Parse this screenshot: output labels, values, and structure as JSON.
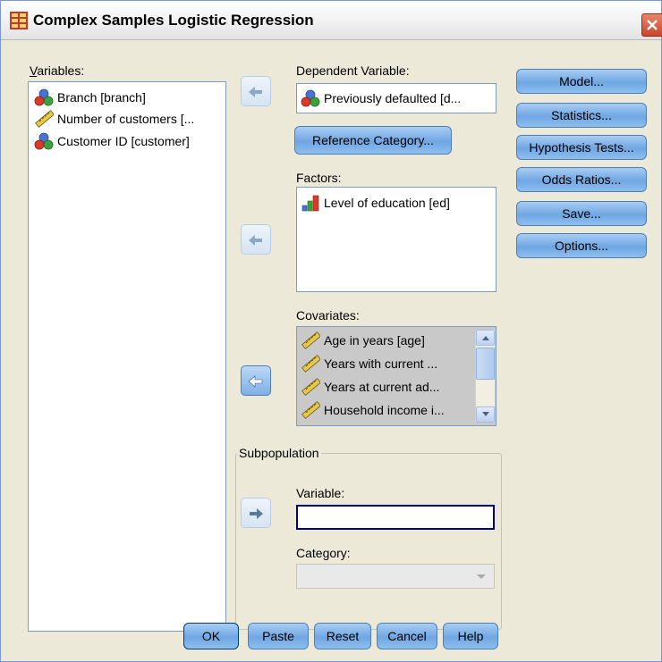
{
  "window": {
    "title": "Complex Samples Logistic Regression"
  },
  "variables": {
    "label": "Variables:",
    "items": [
      {
        "label": "Branch [branch]",
        "icon": "nominal-icon"
      },
      {
        "label": "Number of customers [...",
        "icon": "scale-icon"
      },
      {
        "label": "Customer ID [customer]",
        "icon": "nominal-icon"
      }
    ]
  },
  "dependent": {
    "label": "Dependent Variable:",
    "value": "Previously defaulted [d...",
    "icon": "nominal-icon"
  },
  "reference_category_button": "Reference Category...",
  "factors": {
    "label": "Factors:",
    "items": [
      {
        "label": "Level of education [ed]",
        "icon": "ordinal-icon"
      }
    ]
  },
  "covariates": {
    "label": "Covariates:",
    "items": [
      {
        "label": "Age in years [age]",
        "icon": "scale-icon"
      },
      {
        "label": "Years with current ...",
        "icon": "scale-icon"
      },
      {
        "label": "Years at current ad...",
        "icon": "scale-icon"
      },
      {
        "label": "Household income i...",
        "icon": "scale-icon"
      }
    ]
  },
  "subpopulation": {
    "group_label": "Subpopulation",
    "variable_label": "Variable:",
    "variable_value": "",
    "category_label": "Category:",
    "category_value": ""
  },
  "side_buttons": {
    "model": "Model...",
    "statistics": "Statistics...",
    "hypothesis_tests": "Hypothesis Tests...",
    "odds_ratios": "Odds Ratios...",
    "save": "Save...",
    "options": "Options..."
  },
  "bottom_buttons": {
    "ok": "OK",
    "paste": "Paste",
    "reset": "Reset",
    "cancel": "Cancel",
    "help": "Help"
  },
  "colors": {
    "dialog_bg": "#ece9d8",
    "button_blue": "#8ebfef",
    "field_border": "#7f9db9",
    "selected_list_bg": "#c9c9c9",
    "active_input_border": "#00008b"
  }
}
